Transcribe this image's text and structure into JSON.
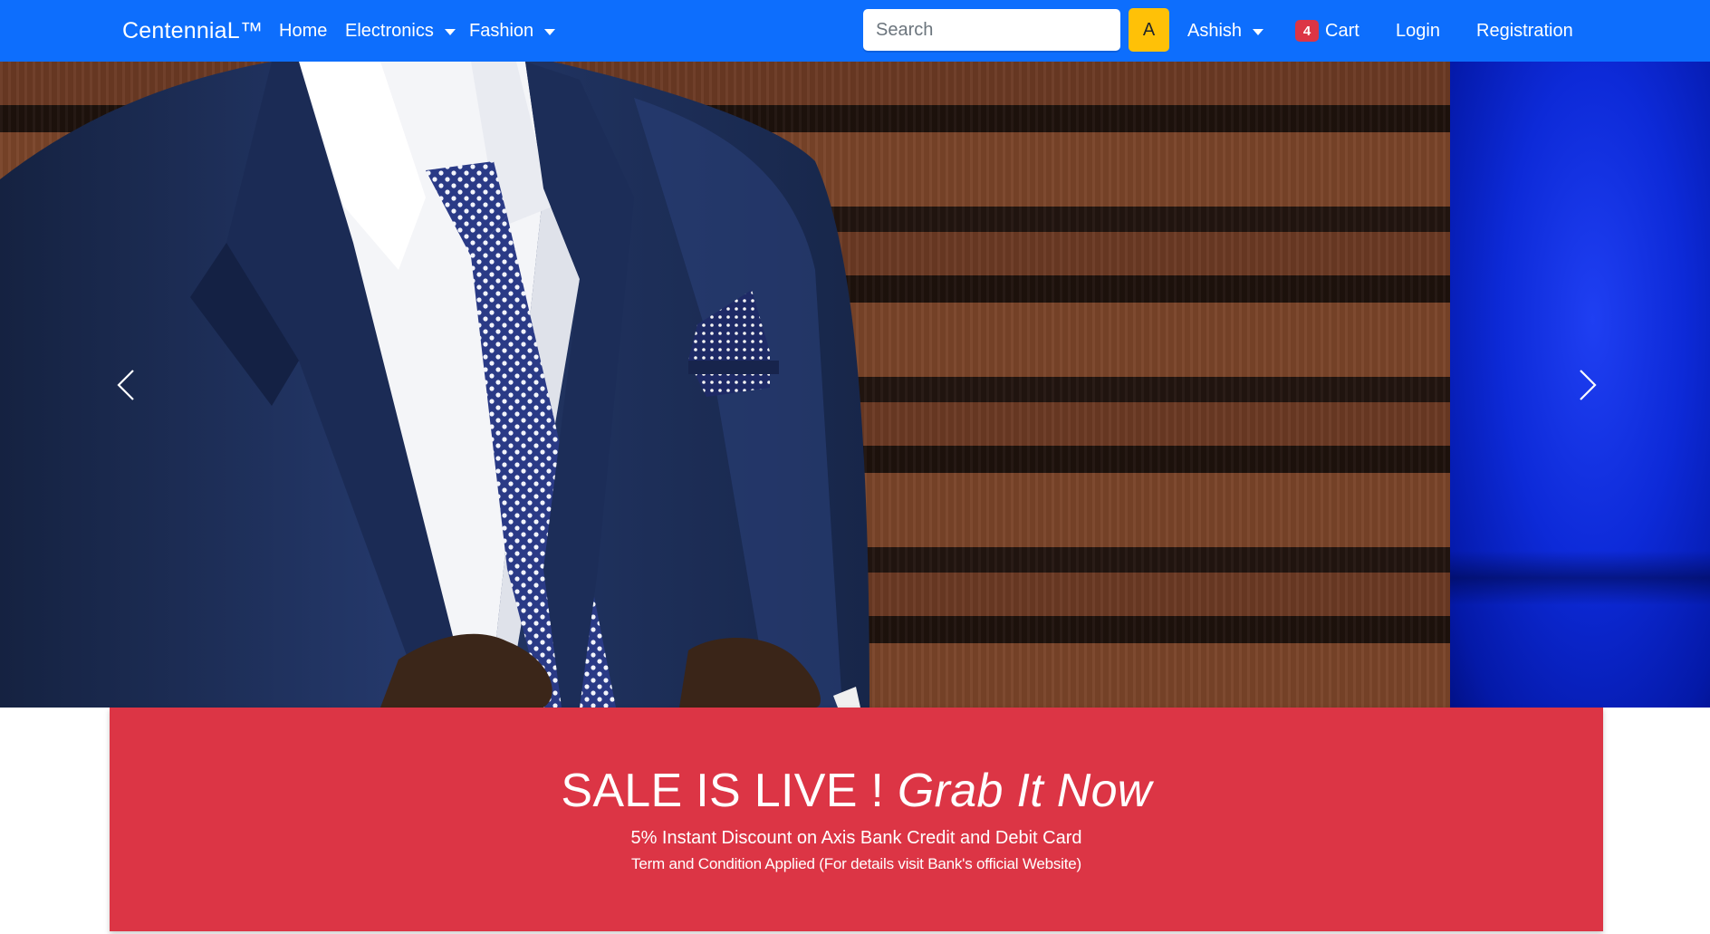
{
  "navbar": {
    "brand": "CentenniaL™",
    "links": {
      "home": "Home",
      "electronics": "Electronics",
      "fashion": "Fashion"
    },
    "search": {
      "placeholder": "Search",
      "button_label": "A"
    },
    "user": "Ashish",
    "cart": {
      "count": "4",
      "label": "Cart"
    },
    "login": "Login",
    "registration": "Registration"
  },
  "carousel": {
    "prev_icon": "chevron-left-icon",
    "next_icon": "chevron-right-icon"
  },
  "sale": {
    "heading_prefix": "SALE IS LIVE ! ",
    "heading_emphasis": "Grab It Now",
    "offer": "5% Instant Discount on Axis Bank Credit and Debit Card",
    "terms": "Term and Condition Applied (For details visit Bank's official Website)"
  },
  "colors": {
    "navbar": "#0d6efd",
    "search_button": "#ffc107",
    "cart_badge": "#dc3545",
    "sale_banner": "#dc3545"
  }
}
